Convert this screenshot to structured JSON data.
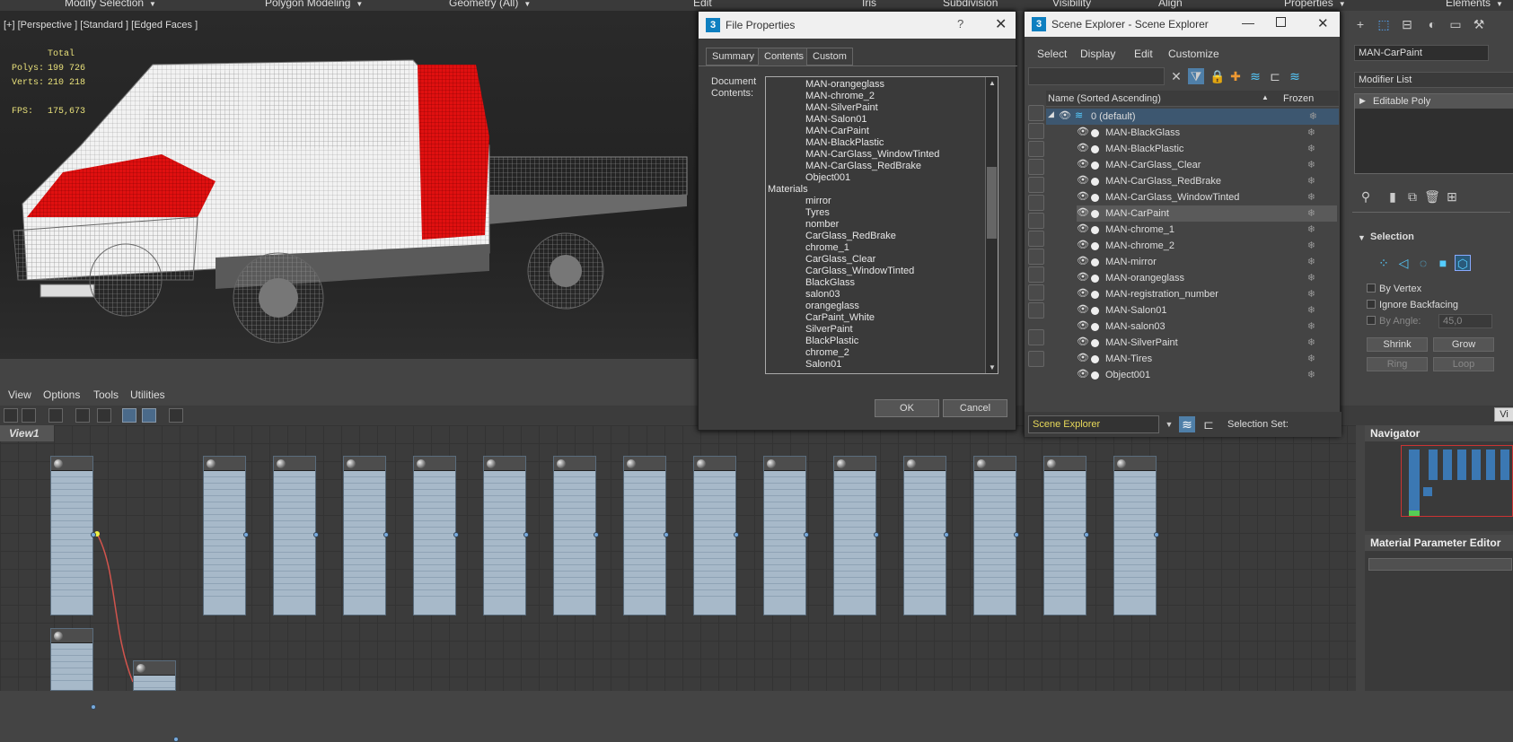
{
  "ribbon": {
    "items": [
      {
        "label": "Modify Selection",
        "caret": true
      },
      {
        "label": "Polygon Modeling",
        "caret": true
      },
      {
        "label": "Geometry (All)",
        "caret": true
      },
      {
        "label": "Edit"
      },
      {
        "label": "Iris"
      },
      {
        "label": "Subdivision"
      },
      {
        "label": "Visibility"
      },
      {
        "label": "Align"
      },
      {
        "label": "Properties",
        "caret": true
      },
      {
        "label": "Elements",
        "caret": true
      }
    ]
  },
  "viewport": {
    "label": "[+] [Perspective ] [Standard ] [Edged Faces ]",
    "stats": {
      "total_label": "Total",
      "polys_label": "Polys:",
      "polys_value": "199 726",
      "verts_label": "Verts:",
      "verts_value": "210 218",
      "fps_label": "FPS:",
      "fps_value": "175,673"
    }
  },
  "menu2": {
    "items": [
      "View",
      "Options",
      "Tools",
      "Utilities"
    ]
  },
  "slate": {
    "view_tab": "View1",
    "node_count": 18
  },
  "navigator": {
    "title": "Navigator"
  },
  "mpe": {
    "title": "Material Parameter Editor"
  },
  "command_panel": {
    "object_name": "MAN-CarPaint",
    "modifier_list_label": "Modifier List",
    "modifier_stack_item": "Editable Poly",
    "selection_title": "Selection",
    "by_vertex": "By Vertex",
    "ignore_backfacing": "Ignore Backfacing",
    "by_angle_label": "By Angle:",
    "by_angle_value": "45,0",
    "shrink_label": "Shrink",
    "grow_label": "Grow",
    "ring_label": "Ring",
    "loop_label": "Loop",
    "vi_label": "Vi"
  },
  "file_properties": {
    "title": "File Properties",
    "help_glyph": "?",
    "tabs": [
      "Summary",
      "Contents",
      "Custom"
    ],
    "selected_tab": "Contents",
    "doc_contents_label": "Document Contents:",
    "list": [
      {
        "text": "MAN-orangeglass",
        "indent": true
      },
      {
        "text": "MAN-chrome_2",
        "indent": true
      },
      {
        "text": "MAN-SilverPaint",
        "indent": true
      },
      {
        "text": "MAN-Salon01",
        "indent": true
      },
      {
        "text": "MAN-CarPaint",
        "indent": true
      },
      {
        "text": "MAN-BlackPlastic",
        "indent": true
      },
      {
        "text": "MAN-CarGlass_WindowTinted",
        "indent": true
      },
      {
        "text": "MAN-CarGlass_RedBrake",
        "indent": true
      },
      {
        "text": "Object001",
        "indent": true
      },
      {
        "text": "Materials",
        "indent": false
      },
      {
        "text": "mirror",
        "indent": true
      },
      {
        "text": "Tyres",
        "indent": true
      },
      {
        "text": "nomber",
        "indent": true
      },
      {
        "text": "CarGlass_RedBrake",
        "indent": true
      },
      {
        "text": "chrome_1",
        "indent": true
      },
      {
        "text": "CarGlass_Clear",
        "indent": true
      },
      {
        "text": "CarGlass_WindowTinted",
        "indent": true
      },
      {
        "text": "BlackGlass",
        "indent": true
      },
      {
        "text": "salon03",
        "indent": true
      },
      {
        "text": "orangeglass",
        "indent": true
      },
      {
        "text": "CarPaint_White",
        "indent": true
      },
      {
        "text": "SilverPaint",
        "indent": true
      },
      {
        "text": "BlackPlastic",
        "indent": true
      },
      {
        "text": "chrome_2",
        "indent": true
      },
      {
        "text": "Salon01",
        "indent": true
      }
    ],
    "ok_label": "OK",
    "cancel_label": "Cancel"
  },
  "scene_explorer": {
    "title": "Scene Explorer - Scene Explorer",
    "menu": [
      "Select",
      "Display",
      "Edit",
      "Customize"
    ],
    "column_name": "Name (Sorted Ascending)",
    "sort_glyph": "▲",
    "column_frozen": "Frozen",
    "layer_name": "0 (default)",
    "rows": [
      {
        "name": "MAN-BlackGlass",
        "selected": false
      },
      {
        "name": "MAN-BlackPlastic",
        "selected": false
      },
      {
        "name": "MAN-CarGlass_Clear",
        "selected": false
      },
      {
        "name": "MAN-CarGlass_RedBrake",
        "selected": false
      },
      {
        "name": "MAN-CarGlass_WindowTinted",
        "selected": false
      },
      {
        "name": "MAN-CarPaint",
        "selected": true
      },
      {
        "name": "MAN-chrome_1",
        "selected": false
      },
      {
        "name": "MAN-chrome_2",
        "selected": false
      },
      {
        "name": "MAN-mirror",
        "selected": false
      },
      {
        "name": "MAN-orangeglass",
        "selected": false
      },
      {
        "name": "MAN-registration_number",
        "selected": false
      },
      {
        "name": "MAN-Salon01",
        "selected": false
      },
      {
        "name": "MAN-salon03",
        "selected": false
      },
      {
        "name": "MAN-SilverPaint",
        "selected": false
      },
      {
        "name": "MAN-Tires",
        "selected": false
      },
      {
        "name": "Object001",
        "selected": false
      }
    ],
    "footer_dropdown": "Scene Explorer",
    "selection_set_label": "Selection Set:"
  }
}
